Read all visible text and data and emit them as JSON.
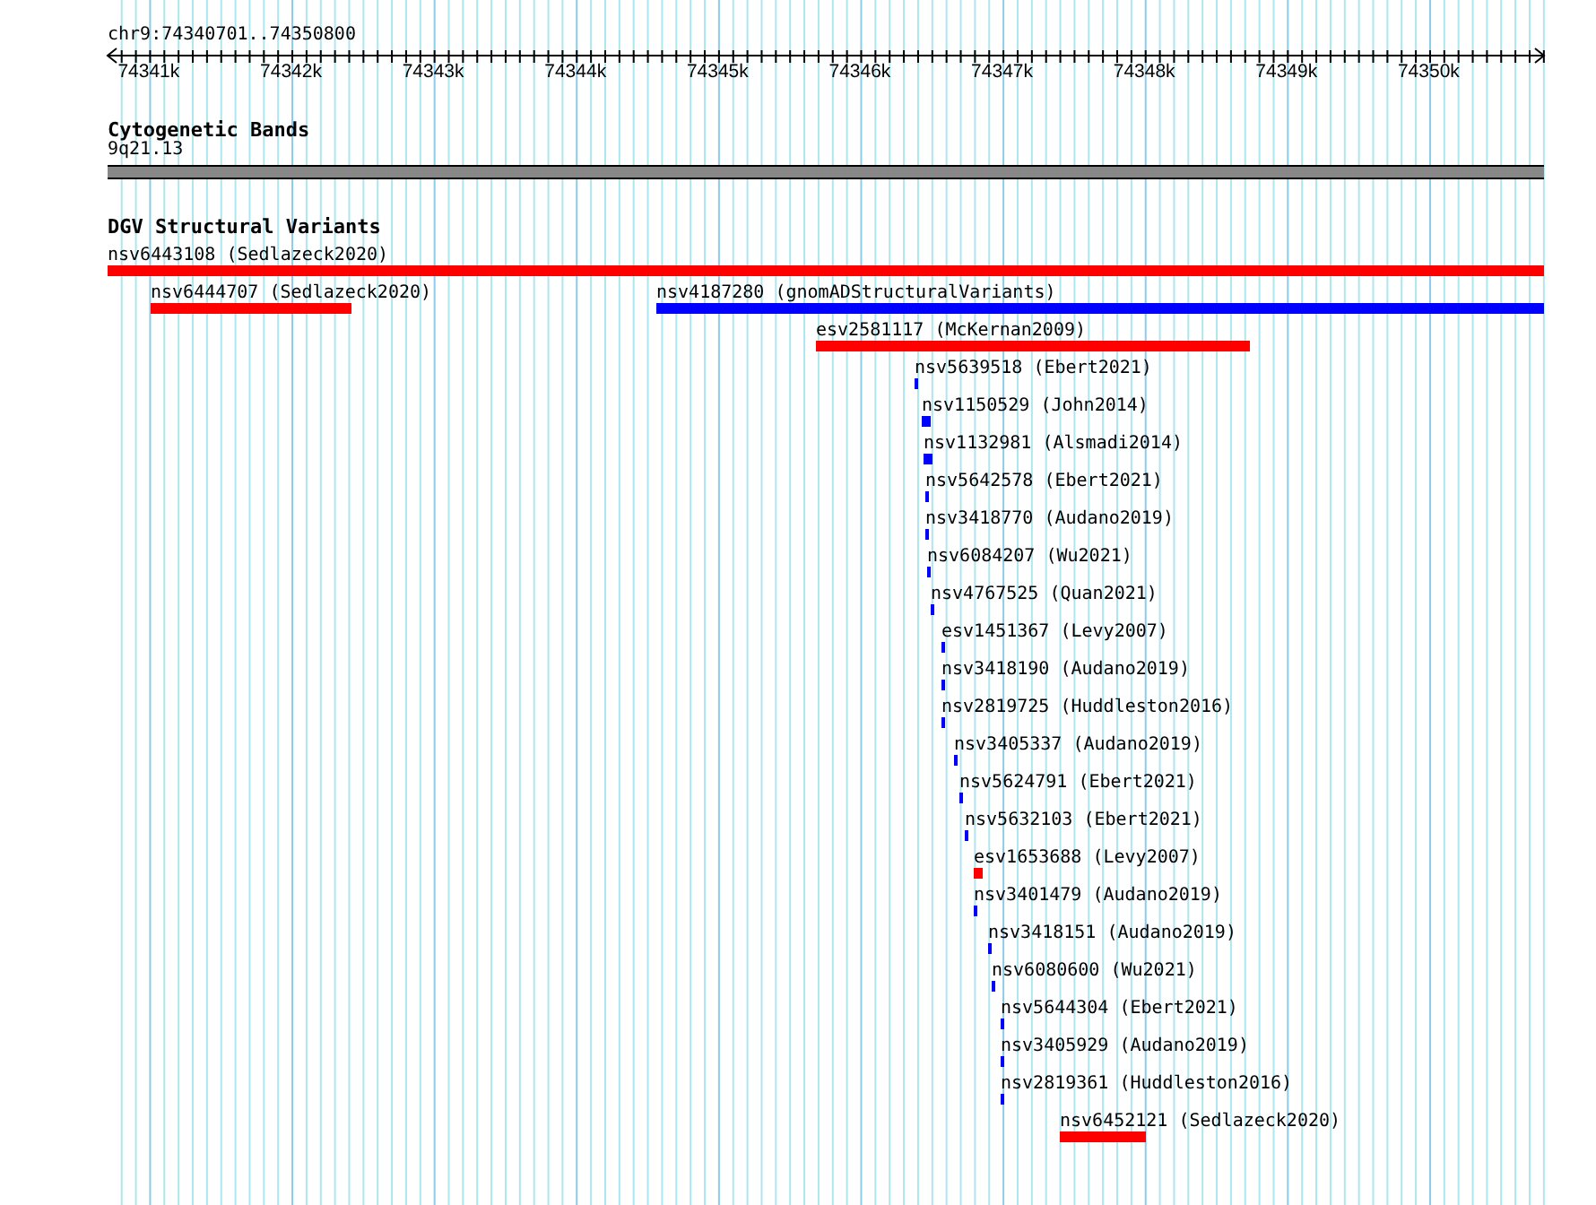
{
  "location": "chr9:74340701..74350800",
  "ruler": {
    "ticks": [
      "74341k",
      "74342k",
      "74343k",
      "74344k",
      "74345k",
      "74346k",
      "74347k",
      "74348k",
      "74349k",
      "74350k"
    ]
  },
  "tracks": [
    {
      "kind": "bands",
      "title": "Cytogenetic Bands",
      "features": [
        {
          "label": "9q21.13"
        }
      ]
    },
    {
      "kind": "variants",
      "title": "DGV Structural Variants",
      "features": [
        {
          "label": "nsv6443108 (Sedlazeck2020)",
          "color": "#ff0000"
        },
        {
          "label": "nsv6444707 (Sedlazeck2020)",
          "color": "#ff0000"
        },
        {
          "label": "nsv4187280 (gnomADStructuralVariants)",
          "color": "#0000ff"
        },
        {
          "label": "esv2581117 (McKernan2009)",
          "color": "#ff0000"
        },
        {
          "label": "nsv5639518 (Ebert2021)",
          "color": "#0000ff"
        },
        {
          "label": "nsv1150529 (John2014)",
          "color": "#0000ff"
        },
        {
          "label": "nsv1132981 (Alsmadi2014)",
          "color": "#0000ff"
        },
        {
          "label": "nsv5642578 (Ebert2021)",
          "color": "#0000ff"
        },
        {
          "label": "nsv3418770 (Audano2019)",
          "color": "#0000ff"
        },
        {
          "label": "nsv6084207 (Wu2021)",
          "color": "#0000ff"
        },
        {
          "label": "nsv4767525 (Quan2021)",
          "color": "#0000ff"
        },
        {
          "label": "esv1451367 (Levy2007)",
          "color": "#0000ff"
        },
        {
          "label": "nsv3418190 (Audano2019)",
          "color": "#0000ff"
        },
        {
          "label": "nsv2819725 (Huddleston2016)",
          "color": "#0000ff"
        },
        {
          "label": "nsv3405337 (Audano2019)",
          "color": "#0000ff"
        },
        {
          "label": "nsv5624791 (Ebert2021)",
          "color": "#0000ff"
        },
        {
          "label": "nsv5632103 (Ebert2021)",
          "color": "#0000ff"
        },
        {
          "label": "esv1653688 (Levy2007)",
          "color": "#ff0000"
        },
        {
          "label": "nsv3401479 (Audano2019)",
          "color": "#0000ff"
        },
        {
          "label": "nsv3418151 (Audano2019)",
          "color": "#0000ff"
        },
        {
          "label": "nsv6080600 (Wu2021)",
          "color": "#0000ff"
        },
        {
          "label": "nsv5644304 (Ebert2021)",
          "color": "#0000ff"
        },
        {
          "label": "nsv3405929 (Audano2019)",
          "color": "#0000ff"
        },
        {
          "label": "nsv2819361 (Huddleston2016)",
          "color": "#0000ff"
        },
        {
          "label": "nsv6452121 (Sedlazeck2020)",
          "color": "#ff0000"
        }
      ]
    }
  ]
}
